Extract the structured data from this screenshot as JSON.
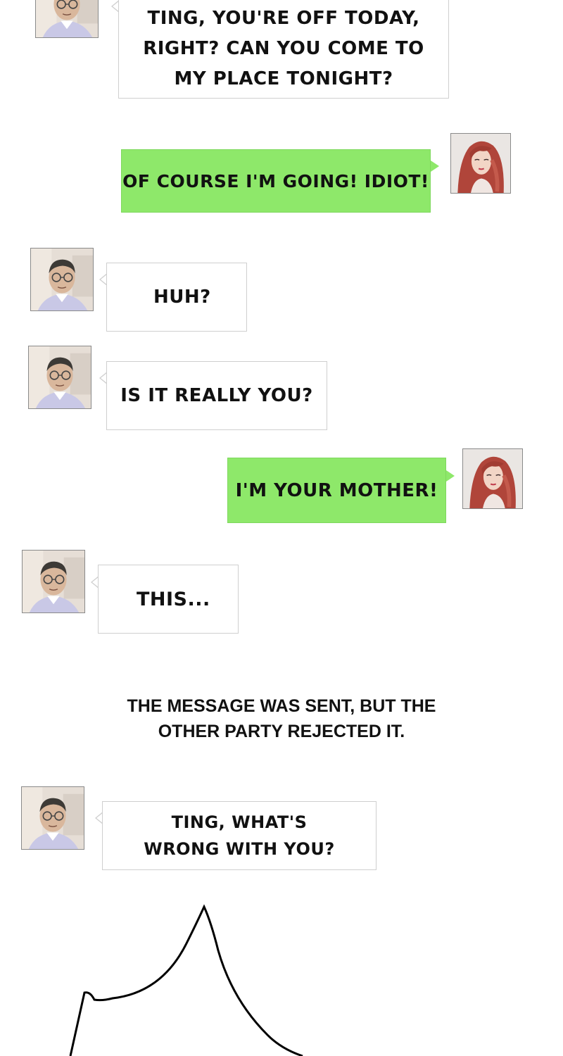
{
  "messages": [
    {
      "sender": "man",
      "text": "TING, YOU'RE OFF TODAY, RIGHT? CAN YOU COME TO MY PLACE TONIGHT?"
    },
    {
      "sender": "woman",
      "text": "OF COURSE I'M GOING! IDIOT!"
    },
    {
      "sender": "man",
      "text": "HUH?"
    },
    {
      "sender": "man",
      "text": "IS IT REALLY YOU?"
    },
    {
      "sender": "woman",
      "text": "I'M YOUR MOTHER!"
    },
    {
      "sender": "man",
      "text": "THIS..."
    },
    {
      "sender": "man",
      "text": "TING, WHAT'S WRONG WITH YOU?"
    }
  ],
  "system_notice": "THE MESSAGE WAS SENT, BUT THE OTHER PARTY REJECTED IT.",
  "icons": {
    "man_avatar": "man-with-glasses-avatar",
    "woman_avatar": "red-haired-woman-avatar"
  },
  "colors": {
    "incoming_bubble": "#ffffff",
    "outgoing_bubble": "#8ee86a",
    "bubble_border": "#cfcfcf"
  }
}
